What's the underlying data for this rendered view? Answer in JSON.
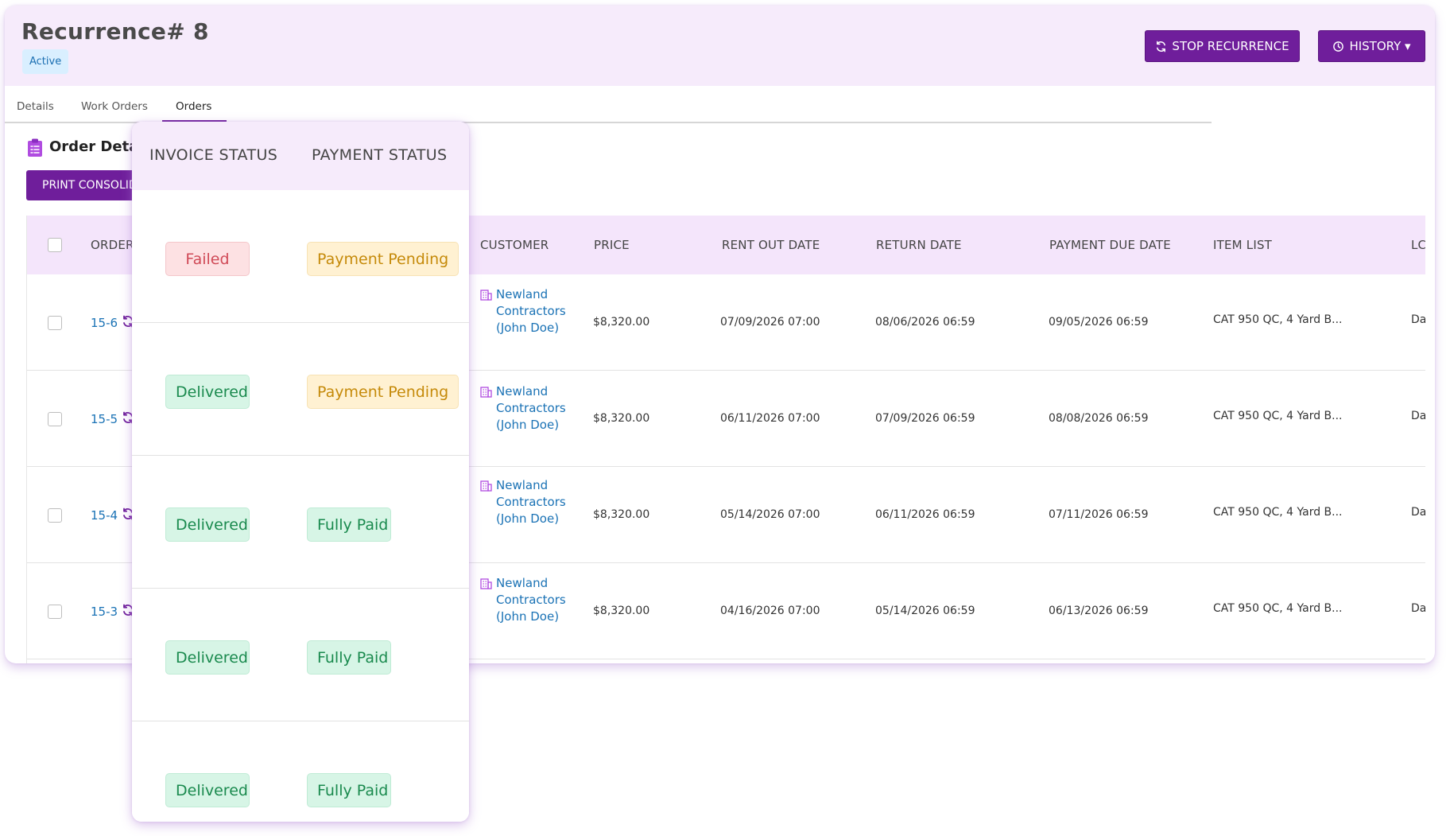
{
  "header": {
    "title": "Recurrence# 8",
    "status_badge": "Active",
    "stop_button": "STOP RECURRENCE",
    "history_button": "HISTORY ▾"
  },
  "tabs": [
    {
      "label": "Details",
      "active": false
    },
    {
      "label": "Work Orders",
      "active": false
    },
    {
      "label": "Orders",
      "active": true
    }
  ],
  "section": {
    "title": "Order Details",
    "print_button": "PRINT CONSOLIDATED"
  },
  "table": {
    "columns": [
      "ORDER",
      "CUSTOMER",
      "PRICE",
      "RENT OUT DATE",
      "RETURN DATE",
      "PAYMENT DUE DATE",
      "ITEM LIST",
      "LC"
    ],
    "rows": [
      {
        "order": "15-6",
        "customer": "Newland Contractors (John Doe)",
        "price": "$8,320.00",
        "rent_out": "07/09/2026 07:00",
        "return": "08/06/2026 06:59",
        "due": "09/05/2026 06:59",
        "items": "CAT 950 QC, 4 Yard B...",
        "lc": "Da"
      },
      {
        "order": "15-5",
        "customer": "Newland Contractors (John Doe)",
        "price": "$8,320.00",
        "rent_out": "06/11/2026 07:00",
        "return": "07/09/2026 06:59",
        "due": "08/08/2026 06:59",
        "items": "CAT 950 QC, 4 Yard B...",
        "lc": "Da"
      },
      {
        "order": "15-4",
        "customer": "Newland Contractors (John Doe)",
        "price": "$8,320.00",
        "rent_out": "05/14/2026 07:00",
        "return": "06/11/2026 06:59",
        "due": "07/11/2026 06:59",
        "items": "CAT 950 QC, 4 Yard B...",
        "lc": "Da"
      },
      {
        "order": "15-3",
        "customer": "Newland Contractors (John Doe)",
        "price": "$8,320.00",
        "rent_out": "04/16/2026 07:00",
        "return": "05/14/2026 06:59",
        "due": "06/13/2026 06:59",
        "items": "CAT 950 QC, 4 Yard B...",
        "lc": "Da"
      }
    ]
  },
  "status_panel": {
    "columns": [
      "INVOICE STATUS",
      "PAYMENT STATUS"
    ],
    "rows": [
      {
        "invoice": "Failed",
        "payment": "Payment Pending"
      },
      {
        "invoice": "Delivered",
        "payment": "Payment Pending"
      },
      {
        "invoice": "Delivered",
        "payment": "Fully Paid"
      },
      {
        "invoice": "Delivered",
        "payment": "Fully Paid"
      },
      {
        "invoice": "Delivered",
        "payment": "Fully Paid"
      }
    ]
  },
  "colors": {
    "accent": "#6f1e9b",
    "header_bg": "#f6ebfb",
    "link": "#1a72b5",
    "failed": "#d04a57",
    "delivered": "#1a8a4e",
    "pending": "#c58a0a"
  },
  "icons": [
    "refresh-icon",
    "history-clock-icon",
    "clipboard-icon",
    "building-icon",
    "recurring-icon"
  ]
}
